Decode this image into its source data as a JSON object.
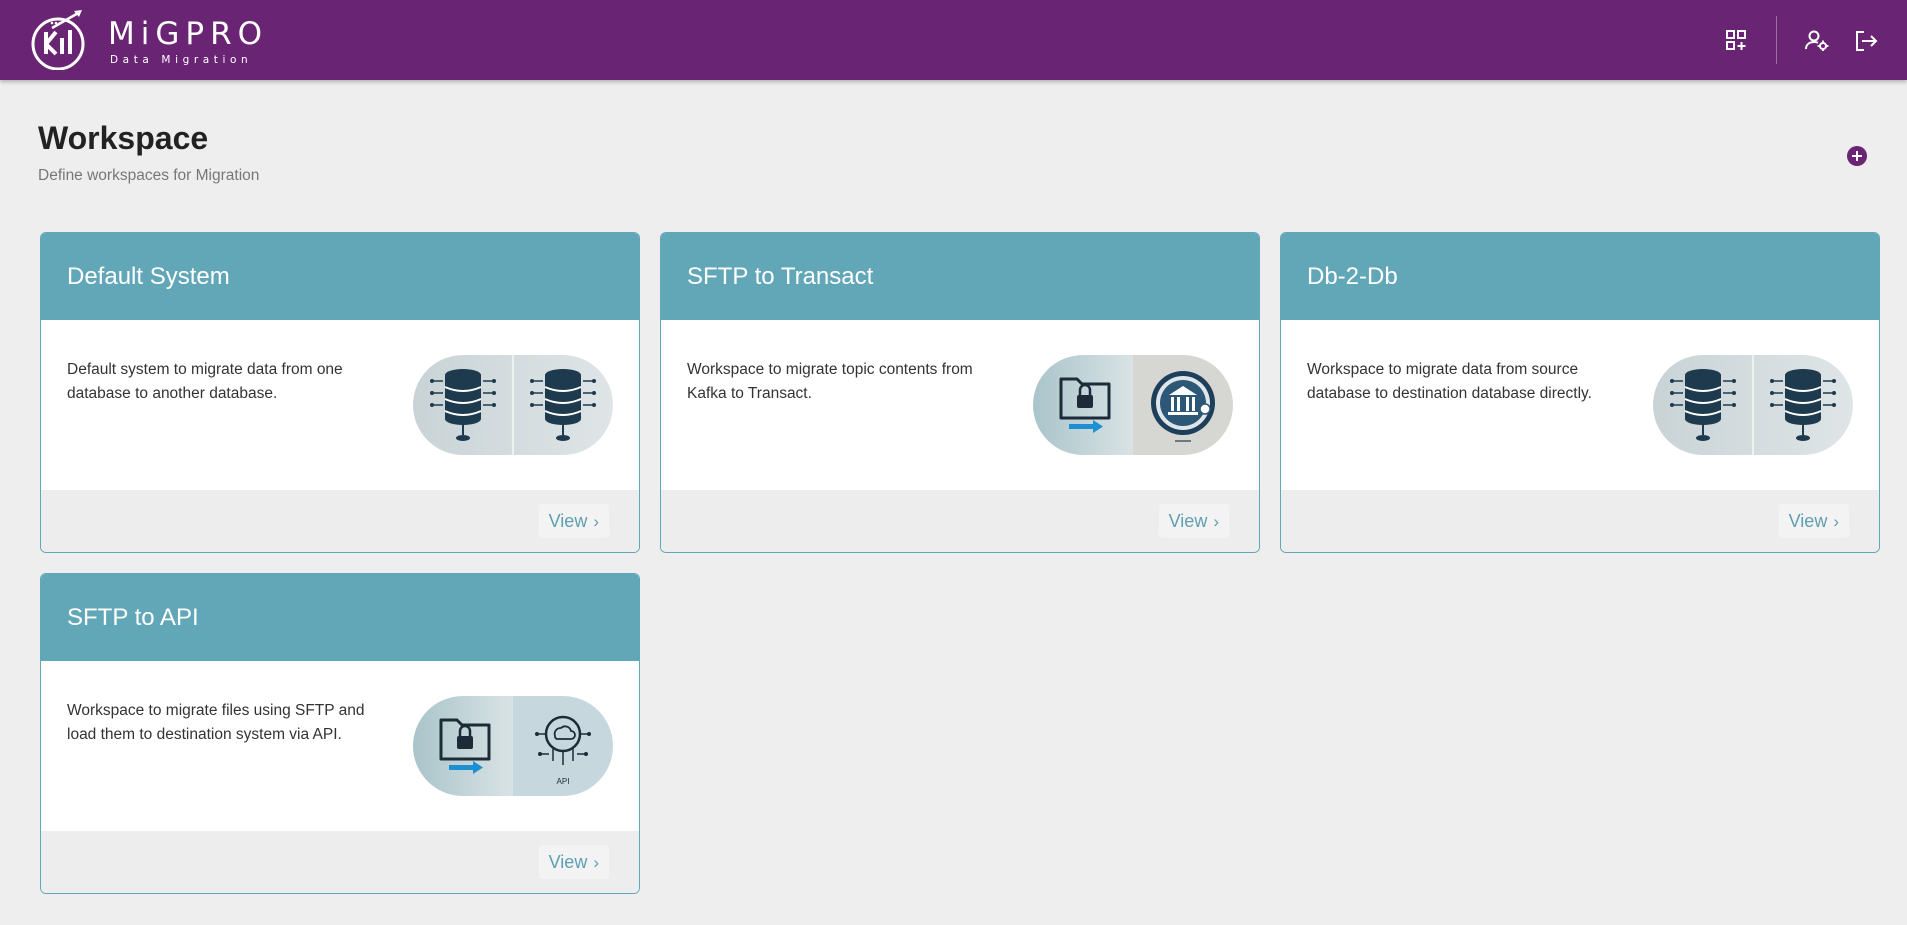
{
  "app": {
    "name": "MiGPRO",
    "tagline": "Data Migration",
    "brand_color": "#6a2474",
    "accent_color": "#62a7b7"
  },
  "header": {
    "actions": [
      {
        "icon": "add-widget-icon"
      },
      {
        "icon": "user-settings-icon"
      },
      {
        "icon": "logout-icon"
      }
    ]
  },
  "page": {
    "title": "Workspace",
    "subtitle": "Define workspaces for Migration",
    "add_icon": "plus-circle-icon"
  },
  "workspaces": [
    {
      "title": "Default System",
      "description": "Default system to migrate data from one database to another database.",
      "image": "database-to-database",
      "view_label": "View"
    },
    {
      "title": "SFTP to Transact",
      "description": "Workspace to migrate topic contents from Kafka to Transact.",
      "image": "folder-to-bank",
      "view_label": "View"
    },
    {
      "title": "Db-2-Db",
      "description": "Workspace to migrate data from source database to destination database directly.",
      "image": "database-to-database",
      "view_label": "View"
    },
    {
      "title": "SFTP to API",
      "description": "Workspace to migrate files using SFTP and load them to destination system via API.",
      "image": "folder-to-api",
      "image_caption": "API",
      "view_label": "View"
    }
  ]
}
